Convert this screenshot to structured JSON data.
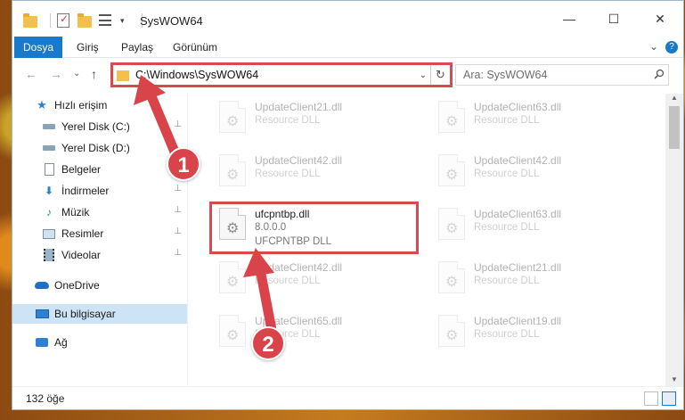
{
  "window": {
    "title": "SysWOW64",
    "minimize_glyph": "—",
    "maximize_glyph": "☐",
    "close_glyph": "✕"
  },
  "ribbon": {
    "tabs": [
      "Dosya",
      "Giriş",
      "Paylaş",
      "Görünüm"
    ],
    "expand_glyph": "⌄",
    "help_glyph": "?"
  },
  "nav": {
    "back_glyph": "←",
    "forward_glyph": "→",
    "recent_glyph": "⌄",
    "up_glyph": "↑",
    "address": "C:\\Windows\\SysWOW64",
    "address_dropdown_glyph": "⌄",
    "refresh_glyph": "↻",
    "search_placeholder": "Ara: SysWOW64",
    "search_glyph": "🔍"
  },
  "sidebar": {
    "items": [
      {
        "label": "Hızlı erişim",
        "icon": "star-icon",
        "pinned": false
      },
      {
        "label": "Yerel Disk (C:)",
        "icon": "drive-icon",
        "pinned": true
      },
      {
        "label": "Yerel Disk (D:)",
        "icon": "drive-icon",
        "pinned": false
      },
      {
        "label": "Belgeler",
        "icon": "documents-icon",
        "pinned": true
      },
      {
        "label": "İndirmeler",
        "icon": "download-icon",
        "pinned": true
      },
      {
        "label": "Müzik",
        "icon": "music-icon",
        "pinned": true
      },
      {
        "label": "Resimler",
        "icon": "pictures-icon",
        "pinned": true
      },
      {
        "label": "Videolar",
        "icon": "videos-icon",
        "pinned": true
      },
      {
        "label": "OneDrive",
        "icon": "cloud-icon",
        "pinned": false
      },
      {
        "label": "Bu bilgisayar",
        "icon": "computer-icon",
        "pinned": false
      },
      {
        "label": "Ağ",
        "icon": "network-icon",
        "pinned": false
      }
    ],
    "pin_glyph": "📌"
  },
  "files": {
    "left": [
      {
        "name": "UpdateClient21.dll",
        "desc": "Resource DLL"
      },
      {
        "name": "UpdateClient42.dll",
        "desc": "Resource DLL"
      },
      {
        "name": "ufcpntbp.dll",
        "desc": "8.0.0.0",
        "desc2": "UFCPNTBP DLL"
      },
      {
        "name": "UpdateClient42.dll",
        "desc": "Resource DLL"
      },
      {
        "name": "UpdateClient65.dll",
        "desc": "Resource DLL"
      }
    ],
    "right": [
      {
        "name": "UpdateClient63.dll",
        "desc": "Resource DLL"
      },
      {
        "name": "UpdateClient42.dll",
        "desc": "Resource DLL"
      },
      {
        "name": "UpdateClient63.dll",
        "desc": "Resource DLL"
      },
      {
        "name": "UpdateClient21.dll",
        "desc": "Resource DLL"
      },
      {
        "name": "UpdateClient19.dll",
        "desc": "Resource DLL"
      }
    ],
    "gear_glyph": "⚙"
  },
  "status": {
    "item_count": "132 öğe"
  },
  "callouts": [
    "1",
    "2"
  ],
  "colors": {
    "accent": "#1979ca",
    "highlight": "#d94a4f",
    "selection": "#cde4f7"
  }
}
